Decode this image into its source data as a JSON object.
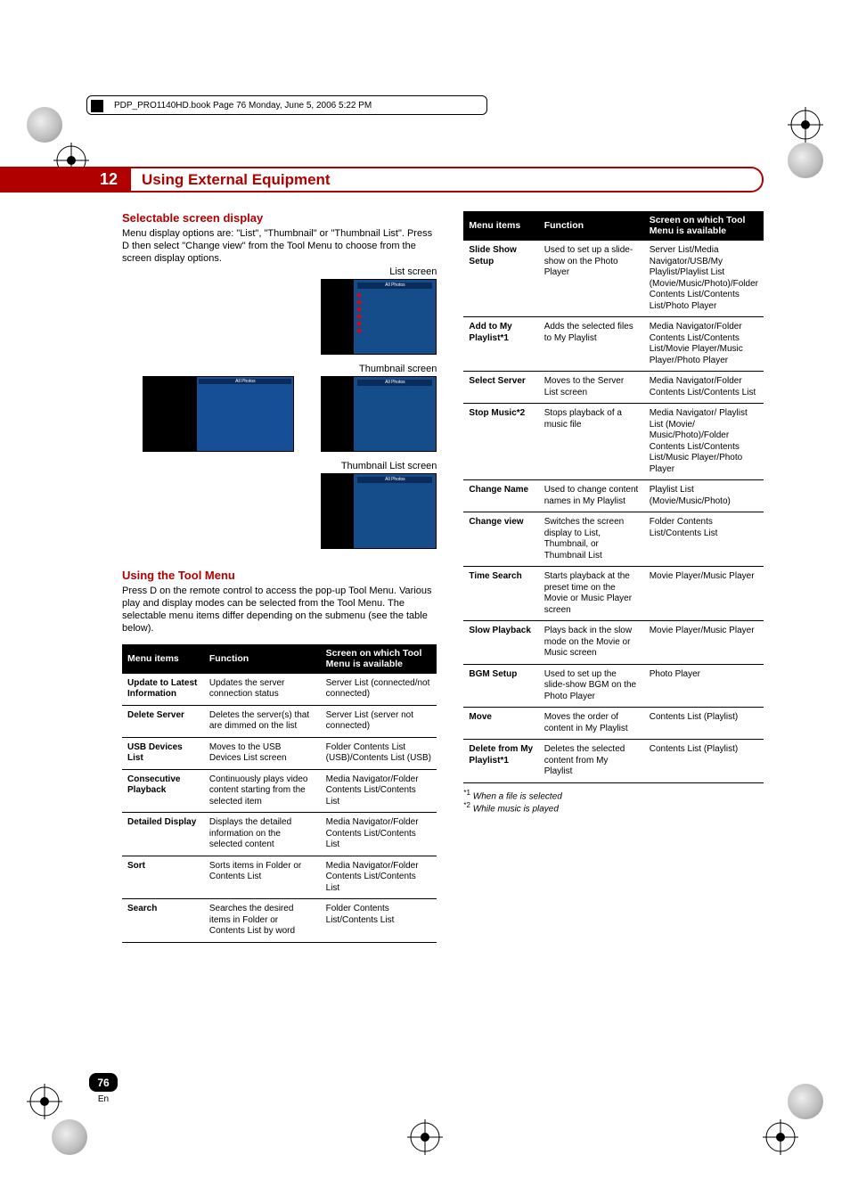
{
  "book_header": "PDP_PRO1140HD.book  Page 76  Monday, June 5, 2006  5:22 PM",
  "chapter": {
    "number": "12",
    "title": "Using External Equipment"
  },
  "page": {
    "number": "76",
    "lang": "En"
  },
  "left": {
    "h1": "Selectable screen display",
    "p1": "Menu display options are: \"List\", \"Thumbnail\" or \"Thumbnail List\". Press D then select \"Change view\" from the Tool Menu to choose from the screen display options.",
    "cap1": "List screen",
    "cap2": "Thumbnail screen",
    "cap3": "Thumbnail List screen",
    "h2": "Using the Tool Menu",
    "p2": "Press D on the remote control to access the pop-up Tool Menu. Various play and display modes can be selected from the Tool Menu. The selectable menu items differ depending on the submenu (see the table below).",
    "table_head": {
      "c1": "Menu items",
      "c2": "Function",
      "c3": "Screen on which Tool Menu is available"
    },
    "rows": [
      {
        "c1": "Update to Latest Information",
        "c2": "Updates the server connection status",
        "c3": "Server List (connected/not connected)"
      },
      {
        "c1": "Delete Server",
        "c2": "Deletes the server(s) that are dimmed on the list",
        "c3": "Server List (server not connected)"
      },
      {
        "c1": "USB Devices List",
        "c2": "Moves to the USB Devices List screen",
        "c3": "Folder Contents List (USB)/Contents List (USB)"
      },
      {
        "c1": "Consecutive Playback",
        "c2": "Continuously plays video content starting from the selected item",
        "c3": "Media Navigator/Folder Contents List/Contents List"
      },
      {
        "c1": "Detailed Display",
        "c2": "Displays the detailed information on the selected content",
        "c3": "Media Navigator/Folder Contents List/Contents List"
      },
      {
        "c1": "Sort",
        "c2": "Sorts items in Folder or Contents List",
        "c3": "Media Navigator/Folder Contents List/Contents List"
      },
      {
        "c1": "Search",
        "c2": "Searches the desired items in Folder or Contents List by word",
        "c3": "Folder Contents List/Contents List"
      }
    ]
  },
  "right": {
    "table_head": {
      "c1": "Menu items",
      "c2": "Function",
      "c3": "Screen on which Tool Menu is available"
    },
    "rows": [
      {
        "c1": "Slide Show Setup",
        "c2": "Used to set up a slide-show on the Photo Player",
        "c3": "Server List/Media Navigator/USB/My Playlist/Playlist List (Movie/Music/Photo)/Folder Contents List/Contents List/Photo Player"
      },
      {
        "c1": "Add to My Playlist*1",
        "c2": "Adds the selected files to My Playlist",
        "c3": "Media Navigator/Folder Contents List/Contents List/Movie Player/Music Player/Photo Player"
      },
      {
        "c1": "Select Server",
        "c2": "Moves to the Server List screen",
        "c3": "Media Navigator/Folder Contents List/Contents List"
      },
      {
        "c1": "Stop Music*2",
        "c2": "Stops playback of a music file",
        "c3": "Media Navigator/ Playlist List (Movie/ Music/Photo)/Folder Contents List/Contents List/Music Player/Photo Player"
      },
      {
        "c1": "Change Name",
        "c2": "Used to change content names in My Playlist",
        "c3": "Playlist List (Movie/Music/Photo)"
      },
      {
        "c1": "Change view",
        "c2": "Switches the screen display to List, Thumbnail, or Thumbnail List",
        "c3": "Folder Contents List/Contents List"
      },
      {
        "c1": "Time Search",
        "c2": "Starts playback at the preset time on the Movie or Music Player screen",
        "c3": "Movie Player/Music Player"
      },
      {
        "c1": "Slow Playback",
        "c2": "Plays back in the slow mode on the Movie or Music screen",
        "c3": "Movie Player/Music Player"
      },
      {
        "c1": "BGM Setup",
        "c2": "Used to set up the slide-show BGM on the Photo Player",
        "c3": "Photo Player"
      },
      {
        "c1": "Move",
        "c2": "Moves the order of content in My Playlist",
        "c3": "Contents List (Playlist)"
      },
      {
        "c1": "Delete from My Playlist*1",
        "c2": "Deletes the selected content from My Playlist",
        "c3": "Contents List (Playlist)"
      }
    ],
    "foot1_mark": "*1",
    "foot1_text": "When a file is selected",
    "foot2_mark": "*2",
    "foot2_text": "While music is played"
  }
}
